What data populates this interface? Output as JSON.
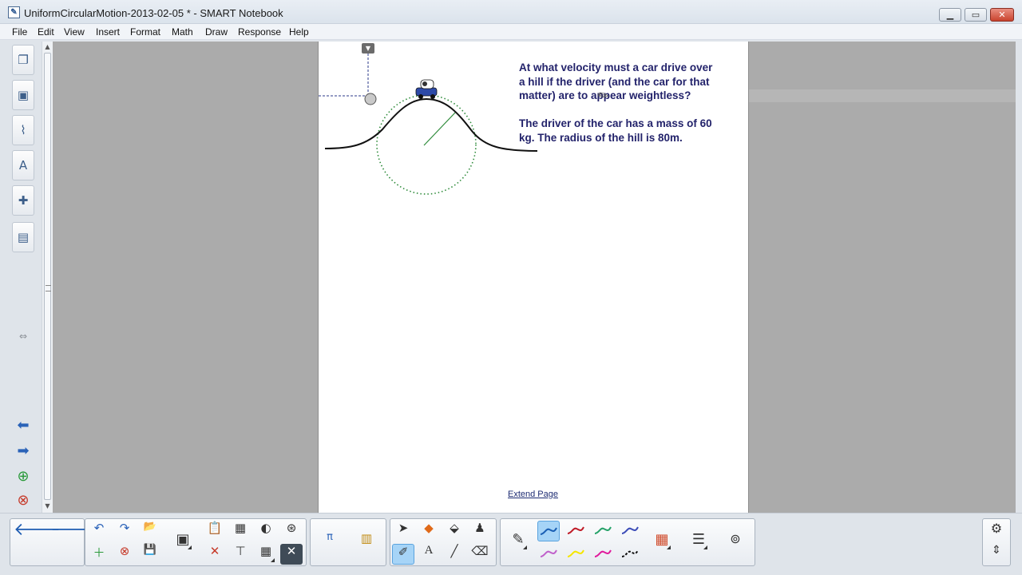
{
  "window": {
    "title": "UniformCircularMotion-2013-02-05 * - SMART Notebook",
    "icon": "notebook-doc-icon",
    "controls": {
      "minimize": "▁",
      "maximize": "▭",
      "close": "✕"
    }
  },
  "menu": [
    "File",
    "Edit",
    "View",
    "Insert",
    "Format",
    "Math",
    "Draw",
    "Response",
    "Help"
  ],
  "side_tabs": [
    {
      "name": "page-sorter-icon",
      "glyph": "❐"
    },
    {
      "name": "gallery-icon",
      "glyph": "▣"
    },
    {
      "name": "attachments-icon",
      "glyph": "⌇"
    },
    {
      "name": "properties-icon",
      "glyph": "A"
    },
    {
      "name": "addons-icon",
      "glyph": "✚"
    },
    {
      "name": "lesson-activity-icon",
      "glyph": "▤"
    }
  ],
  "page": {
    "question_paragraph_1": [
      "At what velocity must a car drive over",
      "a hill if the driver (and the car for that",
      "matter) are to appear weightless?"
    ],
    "question_paragraph_2": [
      "The driver of the car has a mass of 60",
      "kg. The radius of the hill is 80m."
    ],
    "extend_link": "Extend Page"
  },
  "toolbar": {
    "nav": {
      "back": "🡐",
      "forward": "🡒"
    },
    "edit_tools": [
      {
        "name": "undo-icon",
        "glyph": "↶"
      },
      {
        "name": "redo-icon",
        "glyph": "↷"
      },
      {
        "name": "open-folder-icon",
        "glyph": "📂"
      },
      {
        "name": "add-page-icon",
        "glyph": "＋"
      },
      {
        "name": "delete-page-icon",
        "glyph": "⊗"
      },
      {
        "name": "save-icon",
        "glyph": "💾"
      }
    ],
    "accent": "#a6d4f7",
    "pen_colors": [
      "#1a5fb4",
      "#c01c28",
      "#26a269",
      "#3d4db8",
      "#c061cb",
      "#f5e600",
      "#e01b9c",
      "#111111"
    ]
  }
}
